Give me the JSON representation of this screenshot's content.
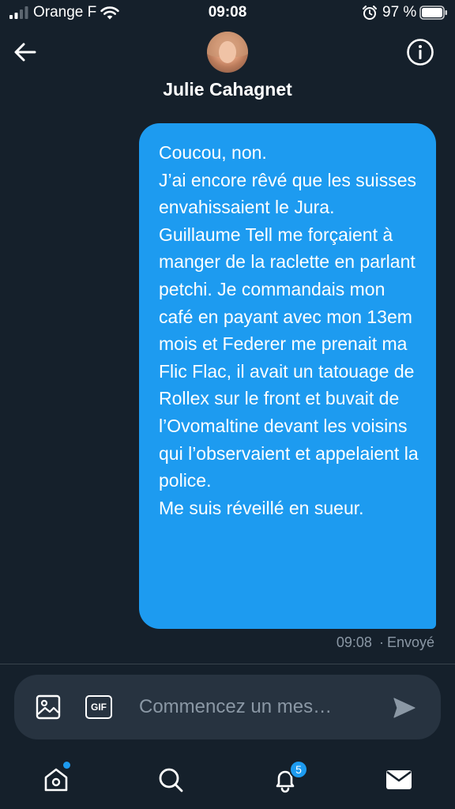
{
  "status_bar": {
    "carrier": "Orange F",
    "time": "09:08",
    "battery": "97 %"
  },
  "header": {
    "contact_name": "Julie Cahagnet",
    "back_icon": "arrow-left-icon",
    "info_icon": "info-icon"
  },
  "conversation": {
    "messages": [
      {
        "direction": "sent",
        "text": "Coucou, non.\nJ’ai encore rêvé que les suisses envahissaient le Jura. Guillaume Tell me forçaient à manger de la raclette en parlant petchi. Je commandais mon café en payant avec mon 13em mois et Federer me prenait ma Flic Flac, il avait un tatouage de Rollex sur le front et buvait de l’Ovomaltine devant les voisins qui l’observaient et appelaient la police.\nMe suis réveillé en sueur.",
        "time": "09:08",
        "separator": "·",
        "status": "Envoyé"
      }
    ]
  },
  "composer": {
    "placeholder": "Commencez un mes…",
    "value": "",
    "gif_label": "GIF",
    "media_icon": "image-icon",
    "send_icon": "send-icon"
  },
  "tab_bar": {
    "notifications_badge": "5",
    "icons": [
      "home-icon",
      "search-icon",
      "bell-icon",
      "mail-icon"
    ]
  },
  "colors": {
    "background": "#15202b",
    "accent": "#1d9bf0",
    "composer": "#273340",
    "muted_text": "#8b98a5"
  }
}
